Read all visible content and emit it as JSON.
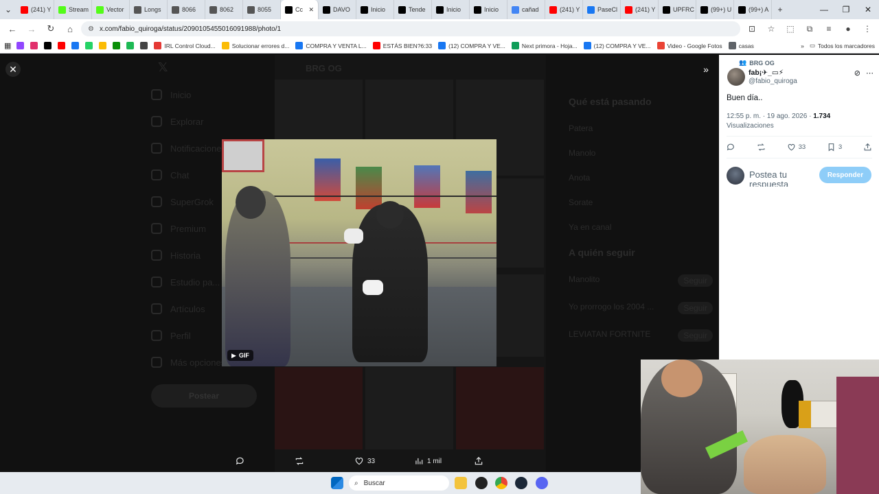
{
  "browser": {
    "tabs": [
      {
        "label": "(241) Y",
        "color": "#ff0000"
      },
      {
        "label": "Stream",
        "color": "#53fc18"
      },
      {
        "label": "Vector",
        "color": "#53fc18"
      },
      {
        "label": "Longs",
        "color": "#555555"
      },
      {
        "label": "8066",
        "color": "#555555"
      },
      {
        "label": "8062",
        "color": "#555555"
      },
      {
        "label": "8055",
        "color": "#555555"
      },
      {
        "label": "Cc",
        "color": "#000000",
        "active": true
      },
      {
        "label": "DAVO",
        "color": "#000000"
      },
      {
        "label": "Inicio",
        "color": "#000000"
      },
      {
        "label": "Tende",
        "color": "#000000"
      },
      {
        "label": "Inicio",
        "color": "#000000"
      },
      {
        "label": "Inicio",
        "color": "#000000"
      },
      {
        "label": "cañad",
        "color": "#4285f4"
      },
      {
        "label": "(241) Y",
        "color": "#ff0000"
      },
      {
        "label": "PaseCl",
        "color": "#1877f2"
      },
      {
        "label": "(241) Y",
        "color": "#ff0000"
      },
      {
        "label": "UPFRC",
        "color": "#000000"
      },
      {
        "label": "(99+) U",
        "color": "#000000"
      },
      {
        "label": "(99+) A",
        "color": "#000000"
      }
    ],
    "url": "x.com/fabio_quiroga/status/2090105455016091988/photo/1",
    "bookmarks": [
      {
        "label": "",
        "color": "#9146ff"
      },
      {
        "label": "",
        "color": "#e1306c"
      },
      {
        "label": "",
        "color": "#000000"
      },
      {
        "label": "",
        "color": "#ff0000"
      },
      {
        "label": "",
        "color": "#1877f2"
      },
      {
        "label": "",
        "color": "#25d366"
      },
      {
        "label": "",
        "color": "#fbbc05"
      },
      {
        "label": "",
        "color": "#0a8f08"
      },
      {
        "label": "",
        "color": "#1db954"
      },
      {
        "label": "",
        "color": "#444444"
      },
      {
        "label": "IRL Control Cloud...",
        "color": "#e53935"
      },
      {
        "label": "Solucionar errores d...",
        "color": "#fbbc05"
      },
      {
        "label": "COMPRA Y VENTA L...",
        "color": "#1877f2"
      },
      {
        "label": "ESTÁS BIEN?6:33",
        "color": "#ff0000"
      },
      {
        "label": "(12) COMPRA Y VE...",
        "color": "#1877f2"
      },
      {
        "label": "Next primora - Hoja...",
        "color": "#0f9d58"
      },
      {
        "label": "(12) COMPRA Y VE...",
        "color": "#1877f2"
      },
      {
        "label": "Video - Google Fotos",
        "color": "#ea4335"
      },
      {
        "label": "casas",
        "color": "#5f6368"
      }
    ],
    "all_bookmarks": "Todos los marcadores"
  },
  "background_page": {
    "nav": [
      "Inicio",
      "Explorar",
      "Notificaciones",
      "Chat",
      "SuperGrok",
      "Premium",
      "Historia",
      "Estudio pa...",
      "Artículos",
      "Perfil",
      "Más opciones"
    ],
    "post_button": "Postear",
    "header": "BRG OG",
    "right_heading": "Qué está pasando",
    "right_items": [
      "Patera",
      "Manolo",
      "Anota",
      "Sorate",
      "Ya en canal"
    ],
    "who_to_follow": "A quién seguir",
    "follow_names": [
      "Manolito",
      "Yo prorrogo los 2004 ...",
      "LEVIATAN FORTNITE"
    ],
    "follow_label": "Seguir"
  },
  "viewer": {
    "gif_label": "GIF",
    "actions": {
      "likes": "33",
      "views": "1 mil"
    }
  },
  "tweet": {
    "context": "BRG OG",
    "display_name": "fab¡✈︎_▭⚡",
    "handle": "@fabio_quiroga",
    "text": "Buen día..",
    "time": "12:55 p. m. · 19 ago. 2026 · ",
    "views_count": "1.734",
    "views_label": "Visualizaciones",
    "likes": "33",
    "bookmarks": "3",
    "reply_placeholder": "Postea tu respuesta",
    "reply_button": "Responder"
  },
  "taskbar": {
    "search_placeholder": "Buscar"
  }
}
